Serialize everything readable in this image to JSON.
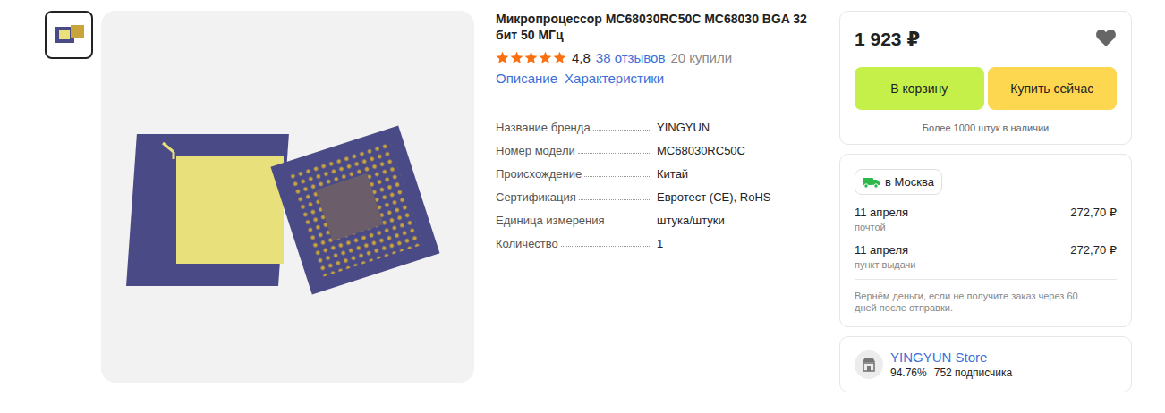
{
  "gallery": {
    "thumbnails": [
      {
        "selected": true
      }
    ]
  },
  "product": {
    "title": "Микропроцессор MC68030RC50C MC68030 BGA 32 бит 50 МГц",
    "stars": 5,
    "rating": "4,8",
    "reviews": "38 отзывов",
    "bought": "20 купили"
  },
  "sections": [
    {
      "label": "Описание"
    },
    {
      "label": "Характеристики"
    }
  ],
  "specs": [
    {
      "label": "Название бренда",
      "value": "YINGYUN"
    },
    {
      "label": "Номер модели",
      "value": "MC68030RC50C"
    },
    {
      "label": "Происхождение",
      "value": "Китай"
    },
    {
      "label": "Сертификация",
      "value": "Евротест (CE), RoHS"
    },
    {
      "label": "Единица измерения",
      "value": "штука/штуки"
    },
    {
      "label": "Количество",
      "value": "1"
    }
  ],
  "purchase": {
    "price": "1 923 ₽",
    "favorite": false,
    "buttons": [
      {
        "label": "В корзину",
        "color": "#c5f04a"
      },
      {
        "label": "Купить сейчас",
        "color": "#fcd74f"
      }
    ],
    "stock": "Более 1000 штук в наличии"
  },
  "delivery": {
    "location": "в Москва",
    "options": [
      {
        "date": "11 апреля",
        "method": "почтой",
        "price": "272,70 ₽"
      },
      {
        "date": "11 апреля",
        "method": "пункт выдачи",
        "price": "272,70 ₽"
      }
    ],
    "guarantee": "Вернём деньги, если не получите заказ через 60 дней после отправки."
  },
  "store": {
    "name": "YINGYUN Store",
    "rating": "94.76%",
    "followers": "752 подписчика"
  }
}
